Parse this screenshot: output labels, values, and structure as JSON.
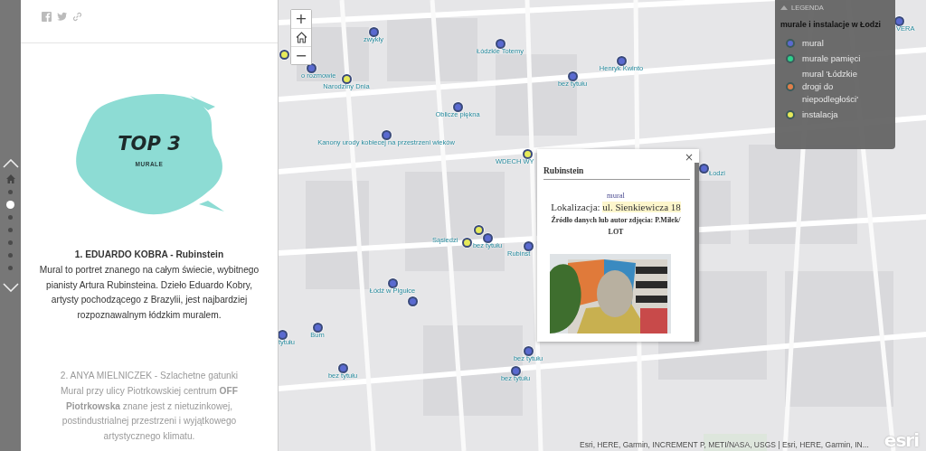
{
  "nav": {
    "dots": [
      {
        "selected": false
      },
      {
        "selected": true
      },
      {
        "selected": false
      },
      {
        "selected": false
      },
      {
        "selected": false
      },
      {
        "selected": false
      },
      {
        "selected": false
      }
    ]
  },
  "story": {
    "title_image": {
      "title": "TOP 3",
      "subtitle": "MURALE"
    },
    "sections": [
      {
        "heading": "1. EDUARDO KOBRA - Rubinstein",
        "text": "Mural to portret znanego na całym świecie, wybitnego pianisty Artura Rubinsteina. Dzieło Eduardo Kobry, artysty pochodzącego z Brazylii, jest najbardziej rozpoznawalnym łódzkim muralem.",
        "active": true
      },
      {
        "heading": "2. ANYA MIELNICZEK - Szlachetne gatunki",
        "text": "Mural przy ulicy Piotrkowskiej centrum **OFF Piotrkowska** znane jest z nietuzinkowej, postindustrialnej przestrzeni i wyjątkowego artystycznego klimatu.",
        "active": false
      }
    ]
  },
  "map": {
    "zoom_controls": [
      {
        "kind": "zoom-in",
        "text": "+"
      },
      {
        "kind": "home"
      },
      {
        "kind": "zoom-out",
        "text": "−"
      }
    ],
    "markers": [
      {
        "label": "zwykły",
        "color": "#5a6ad0"
      },
      {
        "label": "Łódzkie Totemy",
        "color": "#5a6ad0"
      },
      {
        "color": "#e6ea5a"
      },
      {
        "label": "o rozmowie",
        "color": "#5a6ad0"
      },
      {
        "label": "Narodziny Dnia",
        "color": "#e6ea5a"
      },
      {
        "label": "Oblicze piękna",
        "color": "#5a6ad0"
      },
      {
        "label": "bez tytułu",
        "color": "#5a6ad0"
      },
      {
        "label": "Henryk Kwinto",
        "color": "#5a6ad0"
      },
      {
        "label": "Kanony urody kobiecej na przestrzeni wieków",
        "color": "#5a6ad0"
      },
      {
        "label": "WDECH WY",
        "color": "#e6ea5a"
      },
      {
        "color": "#e6ea5a"
      },
      {
        "label": "Sąsiedzi",
        "color": "#e6ea5a"
      },
      {
        "label": "bez tytułu",
        "color": "#5a6ad0"
      },
      {
        "label": "Rubinst",
        "color": "#5a6ad0"
      },
      {
        "label": "Łódź w Pigułce",
        "color": "#5a6ad0"
      },
      {
        "color": "#5a6ad0"
      },
      {
        "label": "Bum",
        "color": "#5a6ad0"
      },
      {
        "label": "tytułu",
        "color": "#5a6ad0"
      },
      {
        "label": "bez tytułu",
        "color": "#5a6ad0"
      },
      {
        "label": "bez tytułu",
        "color": "#5a6ad0"
      },
      {
        "label": "bez tytułu",
        "color": "#5a6ad0"
      },
      {
        "label": "Łodzi",
        "color": "#5a6ad0"
      },
      {
        "label": "VERA",
        "color": "#5a6ad0"
      }
    ],
    "popup": {
      "title": "Rubinstein",
      "close": "×",
      "category": "mural",
      "location_label": "Lokalizacja: ",
      "location": "ul. Sienkiewicza 18",
      "source": "Źródło danych lub autor zdjęcia: P.Miłek/ LOT"
    },
    "legend": {
      "header": "LEGENDA",
      "expanded": true,
      "title": "murale i instalacje w Łodzi",
      "items": [
        {
          "label": "mural",
          "color": "#5a6ad0"
        },
        {
          "label": "murale pamięci",
          "color": "#2ed08c"
        },
        {
          "label": "mural 'Łódzkie drogi do niepodległości'",
          "color": "#e07f4a"
        },
        {
          "label": "instalacja",
          "color": "#e6ea5a"
        }
      ]
    },
    "attribution": "Esri, HERE, Garmin, INCREMENT P, METI/NASA, USGS | Esri, HERE, Garmin, IN...",
    "logo": "esri"
  }
}
